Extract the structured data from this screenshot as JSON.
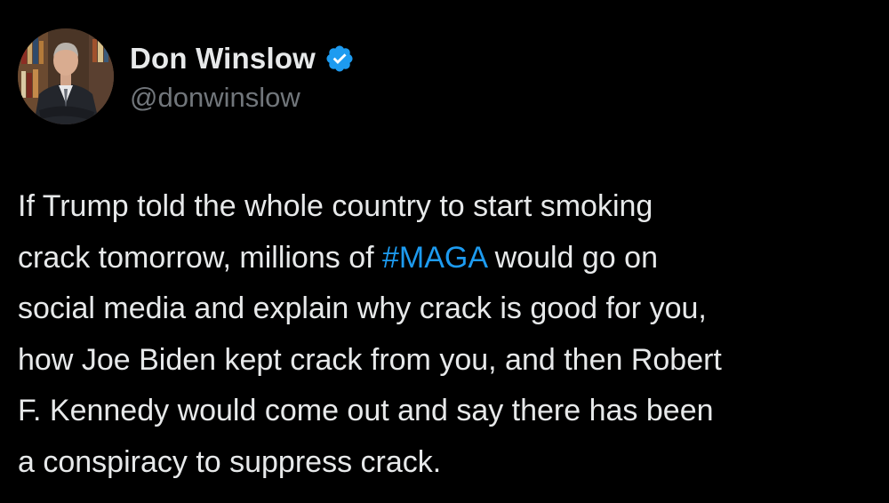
{
  "author": {
    "display_name": "Don Winslow",
    "handle": "@donwinslow",
    "verified": true,
    "avatar_icon": "profile-photo"
  },
  "tweet": {
    "text_before_hashtag": "If Trump told the whole country to start smoking\ncrack tomorrow, millions of ",
    "hashtag": "#MAGA",
    "text_after_hashtag": " would go on\nsocial media and explain why crack is good for you,\nhow Joe Biden kept crack from you, and then Robert\nF. Kennedy would come out and say there has been\na conspiracy to suppress crack."
  },
  "colors": {
    "background": "#000000",
    "text": "#e7e9ea",
    "secondary_text": "#71767b",
    "accent": "#1d9bf0"
  }
}
